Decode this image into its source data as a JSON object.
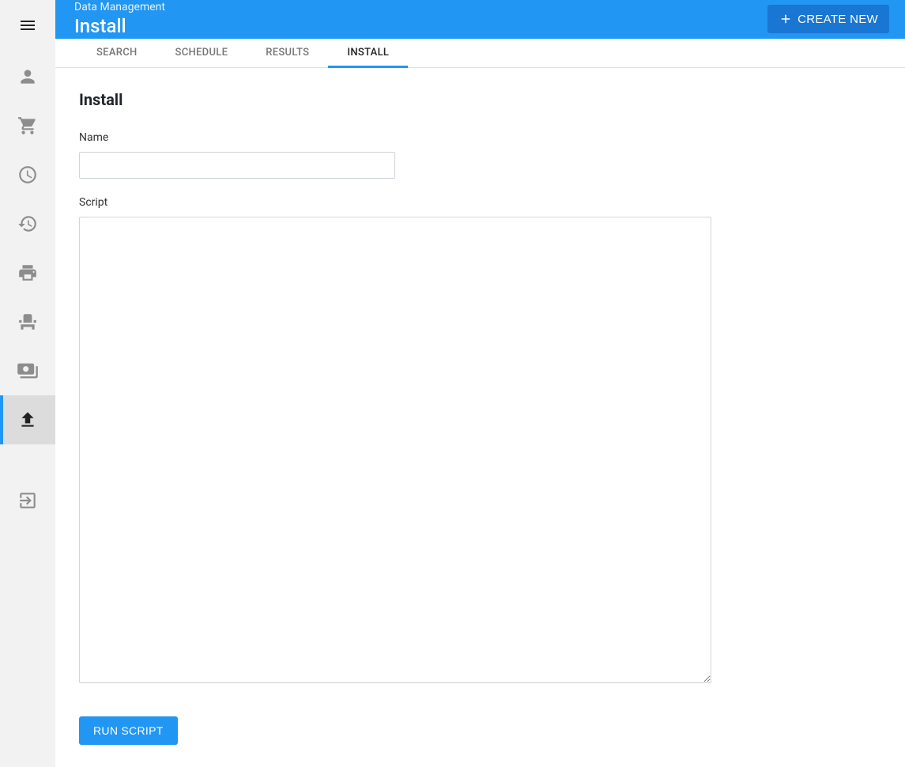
{
  "header": {
    "breadcrumb": "Data Management",
    "title": "Install",
    "create_label": "CREATE NEW"
  },
  "tabs": [
    {
      "label": "SEARCH",
      "active": false
    },
    {
      "label": "SCHEDULE",
      "active": false
    },
    {
      "label": "RESULTS",
      "active": false
    },
    {
      "label": "INSTALL",
      "active": true
    }
  ],
  "form": {
    "heading": "Install",
    "name_label": "Name",
    "name_value": "",
    "script_label": "Script",
    "script_value": "",
    "run_label": "RUN SCRIPT"
  },
  "sidebar": {
    "items": [
      {
        "name": "menu-icon"
      },
      {
        "name": "person-icon"
      },
      {
        "name": "cart-icon"
      },
      {
        "name": "clock-icon"
      },
      {
        "name": "history-icon"
      },
      {
        "name": "print-icon"
      },
      {
        "name": "seat-icon"
      },
      {
        "name": "payments-icon"
      },
      {
        "name": "upload-icon",
        "active": true
      },
      {
        "name": "exit-icon"
      }
    ]
  }
}
